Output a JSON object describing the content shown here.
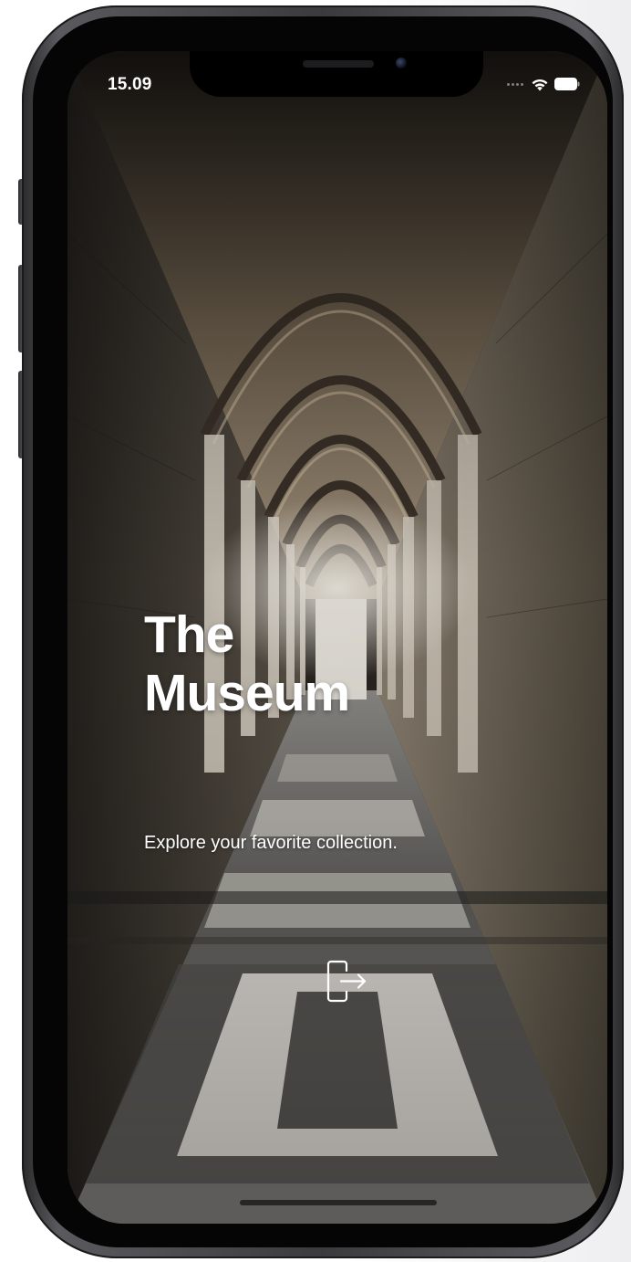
{
  "status_bar": {
    "time": "15.09",
    "wifi_icon": "wifi-icon",
    "battery_icon": "battery-icon",
    "signal_icon": "signal-dots-icon"
  },
  "hero": {
    "title_line1": "The",
    "title_line2": "Museum",
    "subtitle": "Explore your favorite collection."
  },
  "enter_button": {
    "icon": "sign-in-icon"
  },
  "colors": {
    "text": "#ffffff",
    "frame": "#3b3b3e",
    "bezel": "#050505"
  }
}
